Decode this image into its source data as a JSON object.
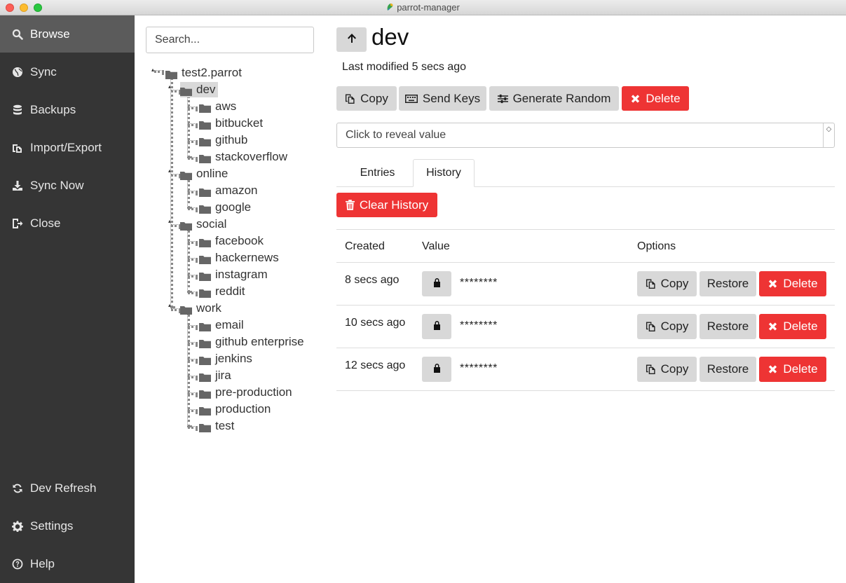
{
  "window": {
    "title": "parrot-manager"
  },
  "sidebar": {
    "items": [
      {
        "label": "Browse",
        "icon": "search-icon"
      },
      {
        "label": "Sync",
        "icon": "globe-icon"
      },
      {
        "label": "Backups",
        "icon": "database-icon"
      },
      {
        "label": "Import/Export",
        "icon": "copy-icon"
      },
      {
        "label": "Sync Now",
        "icon": "download-icon"
      },
      {
        "label": "Close",
        "icon": "sign-out-icon"
      }
    ],
    "bottom_items": [
      {
        "label": "Dev Refresh",
        "icon": "refresh-icon"
      },
      {
        "label": "Settings",
        "icon": "gear-icon"
      },
      {
        "label": "Help",
        "icon": "question-circle-icon"
      }
    ]
  },
  "search": {
    "placeholder": "Search..."
  },
  "tree": {
    "root": "test2.parrot",
    "groups": [
      {
        "label": "dev",
        "children": [
          "aws",
          "bitbucket",
          "github",
          "stackoverflow"
        ]
      },
      {
        "label": "online",
        "children": [
          "amazon",
          "google"
        ]
      },
      {
        "label": "social",
        "children": [
          "facebook",
          "hackernews",
          "instagram",
          "reddit"
        ]
      },
      {
        "label": "work",
        "children": [
          "email",
          "github enterprise",
          "jenkins",
          "jira",
          "pre-production",
          "production",
          "test"
        ]
      }
    ],
    "selected": "dev"
  },
  "entry": {
    "title": "dev",
    "modified": "Last modified 5 secs ago",
    "actions": {
      "copy": "Copy",
      "send_keys": "Send Keys",
      "generate": "Generate Random",
      "delete": "Delete"
    },
    "reveal_placeholder": "Click to reveal value"
  },
  "tabs": [
    {
      "label": "Entries"
    },
    {
      "label": "History"
    }
  ],
  "active_tab": "History",
  "history": {
    "clear_label": "Clear History",
    "columns": {
      "created": "Created",
      "value": "Value",
      "options": "Options"
    },
    "rows": [
      {
        "created": "8 secs ago",
        "value": "********"
      },
      {
        "created": "10 secs ago",
        "value": "********"
      },
      {
        "created": "12 secs ago",
        "value": "********"
      }
    ],
    "row_actions": {
      "copy": "Copy",
      "restore": "Restore",
      "delete": "Delete"
    }
  },
  "colors": {
    "sidebar_bg": "#353535",
    "sidebar_active": "#5b5b5b",
    "danger": "#ee3434",
    "button_grey": "#d8d8d8"
  }
}
